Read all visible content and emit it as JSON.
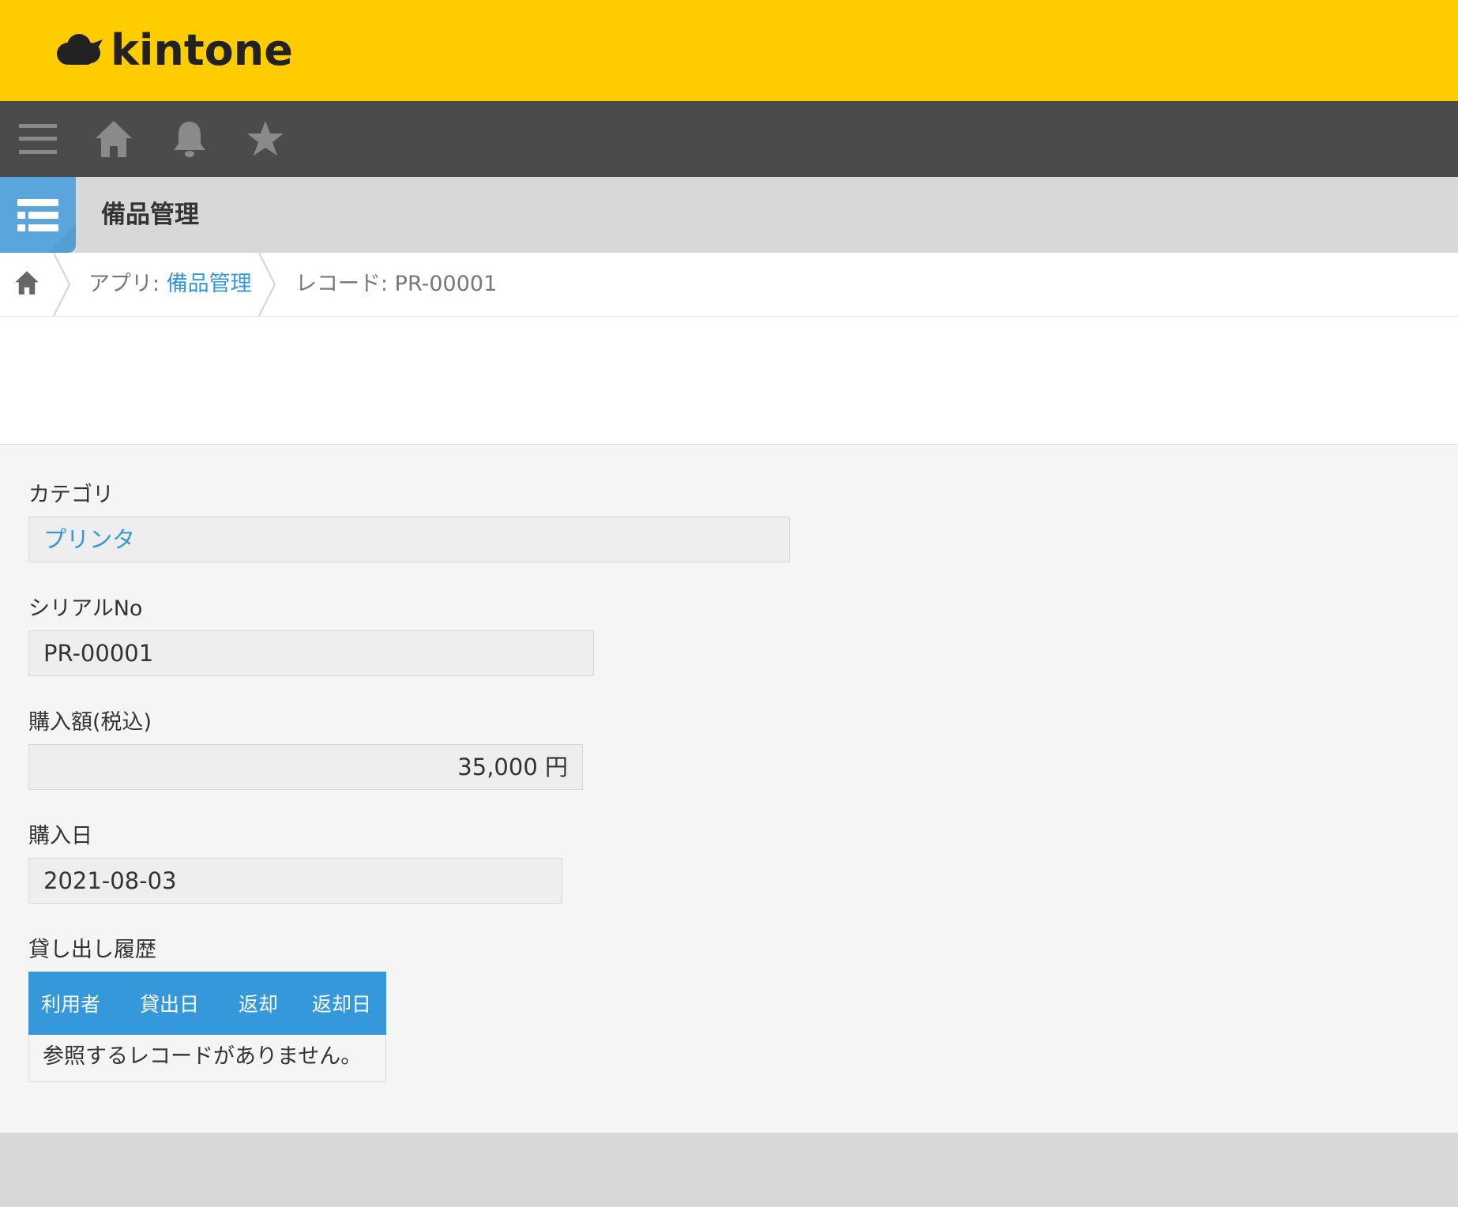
{
  "header": {
    "logo_text": "kintone",
    "brand_color": "#ffcc00"
  },
  "navbar": {
    "icons": [
      "menu-icon",
      "home-icon",
      "bell-icon",
      "star-icon"
    ]
  },
  "app": {
    "title": "備品管理",
    "icon": "list-icon",
    "icon_color": "#5aa6dc"
  },
  "breadcrumb": {
    "app_prefix": "アプリ: ",
    "app_name": "備品管理",
    "record_label": "レコード: PR-00001"
  },
  "record": {
    "fields": {
      "category": {
        "label": "カテゴリ",
        "value": "プリンタ"
      },
      "serial": {
        "label": "シリアルNo",
        "value": "PR-00001"
      },
      "price": {
        "label": "購入額(税込)",
        "value": "35,000 円"
      },
      "date": {
        "label": "購入日",
        "value": "2021-08-03"
      }
    },
    "history": {
      "label": "貸し出し履歴",
      "columns": [
        "利用者",
        "貸出日",
        "返却",
        "返却日"
      ],
      "empty_message": "参照するレコードがありません。"
    }
  },
  "colors": {
    "accent": "#3498db",
    "navbar": "#4b4b4b"
  }
}
